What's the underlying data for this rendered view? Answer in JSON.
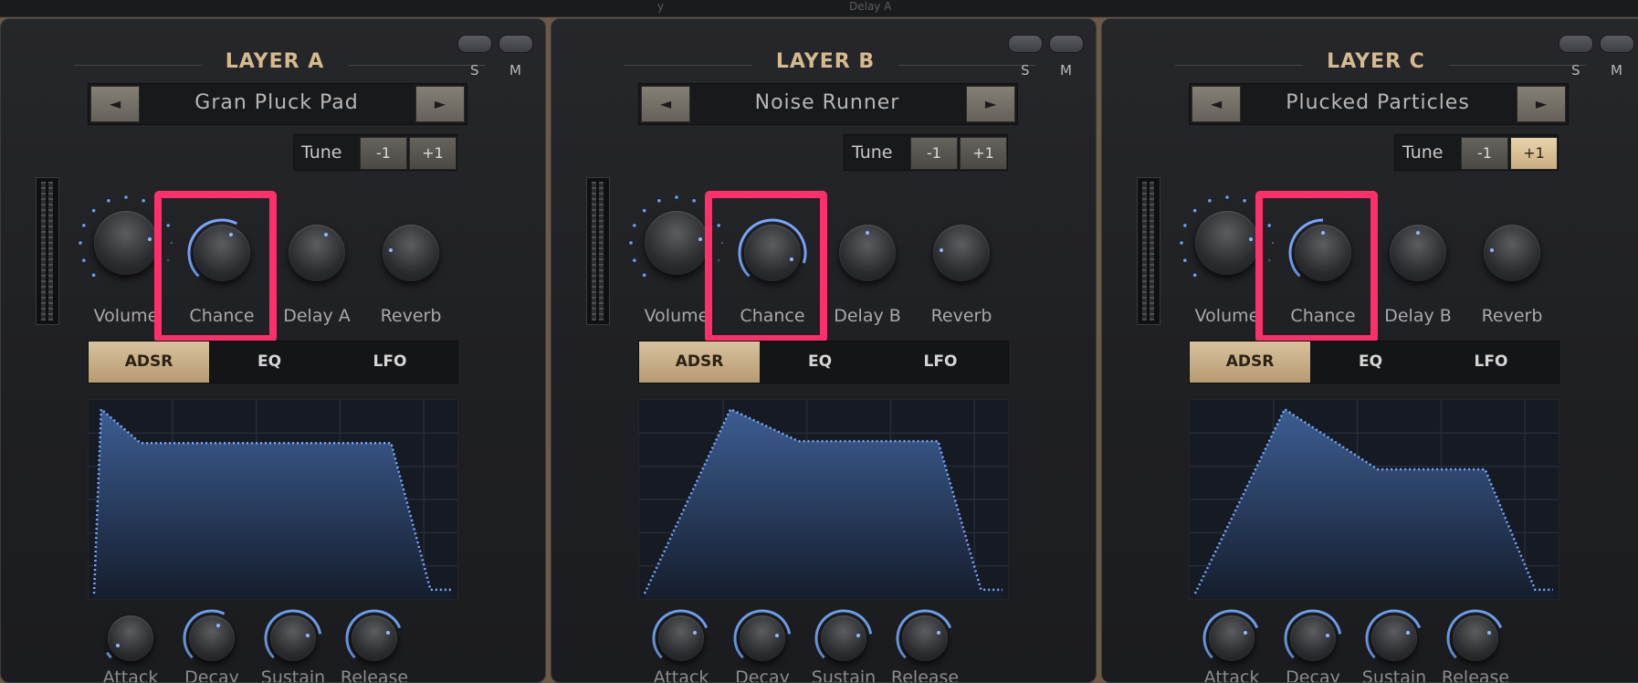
{
  "top_partial_text": [
    "y",
    "Delay A"
  ],
  "accent_color": "#d5b98f",
  "highlight_color": "#ff2f6b",
  "envelope_color": "#7aa7ff",
  "layers": [
    {
      "title": "LAYER A",
      "solo": "S",
      "mute": "M",
      "prev_symbol": "◄",
      "next_symbol": "►",
      "preset": "Gran Pluck Pad",
      "tune_label": "Tune",
      "tune_down": "-1",
      "tune_up": "+1",
      "tune_up_active": false,
      "knobs": [
        {
          "label": "Volume",
          "value": 0.8
        },
        {
          "label": "Chance",
          "value": 0.6
        },
        {
          "label": "Delay A",
          "value": 0.6
        },
        {
          "label": "Reverb",
          "value": 0.2
        }
      ],
      "tabs": [
        "ADSR",
        "EQ",
        "LFO"
      ],
      "active_tab": "ADSR",
      "adsr_knobs": [
        {
          "label": "Attack",
          "value": 0.05
        },
        {
          "label": "Decay",
          "value": 0.6
        },
        {
          "label": "Sustain",
          "value": 0.8
        },
        {
          "label": "Release",
          "value": 0.75
        }
      ]
    },
    {
      "title": "LAYER B",
      "solo": "S",
      "mute": "M",
      "prev_symbol": "◄",
      "next_symbol": "►",
      "preset": "Noise Runner",
      "tune_label": "Tune",
      "tune_down": "-1",
      "tune_up": "+1",
      "tune_up_active": false,
      "knobs": [
        {
          "label": "Volume",
          "value": 0.8
        },
        {
          "label": "Chance",
          "value": 0.9
        },
        {
          "label": "Delay B",
          "value": 0.5
        },
        {
          "label": "Reverb",
          "value": 0.2
        }
      ],
      "tabs": [
        "ADSR",
        "EQ",
        "LFO"
      ],
      "active_tab": "ADSR",
      "adsr_knobs": [
        {
          "label": "Attack",
          "value": 0.75
        },
        {
          "label": "Decay",
          "value": 0.8
        },
        {
          "label": "Sustain",
          "value": 0.8
        },
        {
          "label": "Release",
          "value": 0.75
        }
      ]
    },
    {
      "title": "LAYER C",
      "solo": "S",
      "mute": "M",
      "prev_symbol": "◄",
      "next_symbol": "►",
      "preset": "Plucked Particles",
      "tune_label": "Tune",
      "tune_down": "-1",
      "tune_up": "+1",
      "tune_up_active": true,
      "knobs": [
        {
          "label": "Volume",
          "value": 0.8
        },
        {
          "label": "Chance",
          "value": 0.5
        },
        {
          "label": "Delay B",
          "value": 0.5
        },
        {
          "label": "Reverb",
          "value": 0.2
        }
      ],
      "tabs": [
        "ADSR",
        "EQ",
        "LFO"
      ],
      "active_tab": "ADSR",
      "adsr_knobs": [
        {
          "label": "Attack",
          "value": 0.75
        },
        {
          "label": "Decay",
          "value": 0.8
        },
        {
          "label": "Sustain",
          "value": 0.75
        },
        {
          "label": "Release",
          "value": 0.75
        }
      ]
    }
  ]
}
